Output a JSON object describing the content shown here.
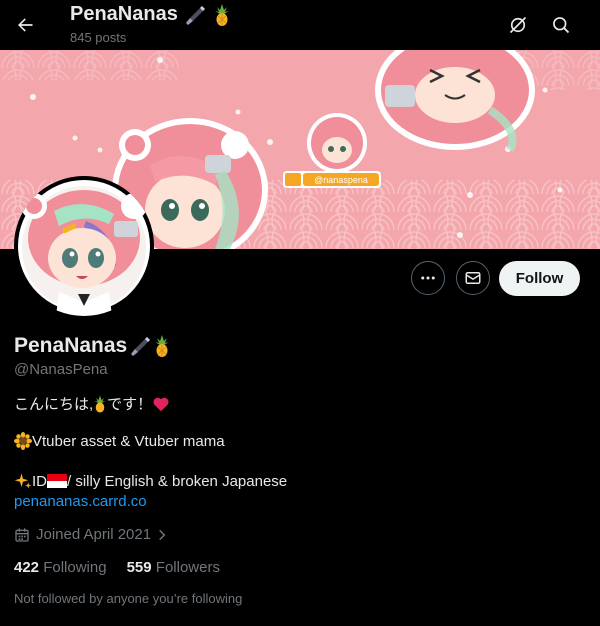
{
  "header": {
    "title": "PenaNanas",
    "post_count": "845 posts"
  },
  "actions": {
    "follow_label": "Follow"
  },
  "banner": {
    "badge_text": "@nanaspena"
  },
  "profile": {
    "name": "PenaNanas",
    "handle": "@NanasPena",
    "bio": {
      "line1_text": "こんにちは,",
      "line1_tail": " です！",
      "line2_text": " Vtuber asset & Vtuber mama",
      "line3_prefix": " ID ",
      "line3_text": " / silly English & broken Japanese"
    },
    "link": "penananas.carrd.co",
    "joined": "Joined April 2021",
    "following_count": "422",
    "following_label": "Following",
    "followers_count": "559",
    "followers_label": "Followers",
    "not_followed": "Not followed by anyone you’re following"
  },
  "colors": {
    "accent_link": "#1d9bf0",
    "banner_pink": "#f3a7ad",
    "hair_pink": "#f08f9a",
    "secondary_text": "#71767b"
  }
}
